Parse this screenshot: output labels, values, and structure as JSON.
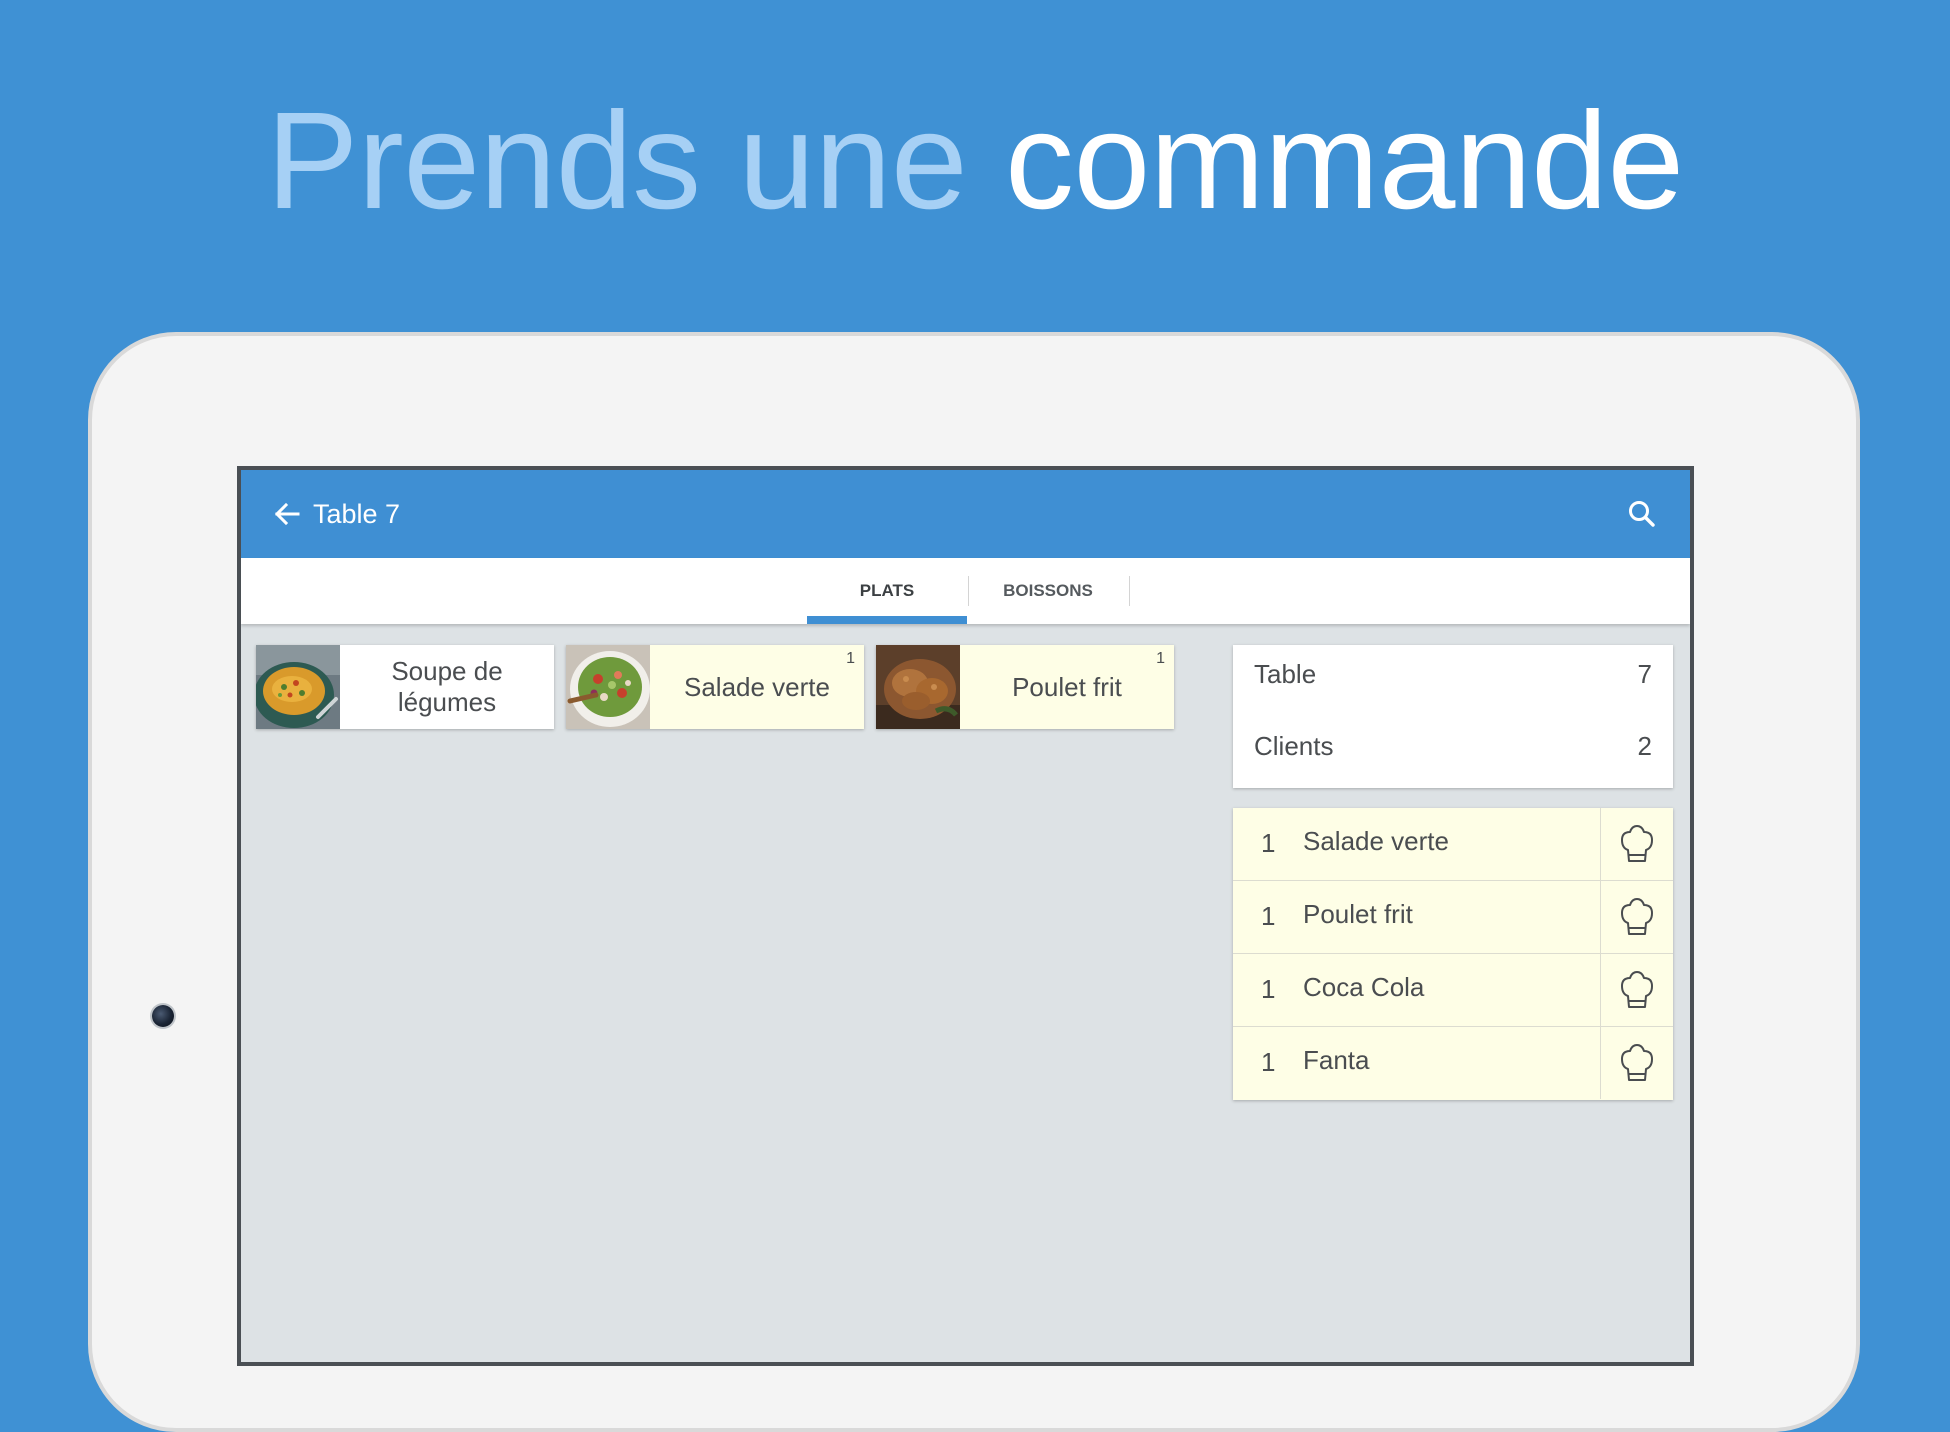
{
  "headline": {
    "light_text": "Prends une",
    "strong_text": "commande"
  },
  "appbar": {
    "title": "Table 7",
    "back_icon": "arrow-back-icon",
    "search_icon": "search-icon"
  },
  "tabs": [
    {
      "label": "PLATS",
      "active": true
    },
    {
      "label": "BOISSONS",
      "active": false
    }
  ],
  "dishes": [
    {
      "name": "Soupe de légumes",
      "count": "",
      "thumb": "soup-bowl-image"
    },
    {
      "name": "Salade verte",
      "count": "1",
      "thumb": "salad-bowl-image"
    },
    {
      "name": "Poulet frit",
      "count": "1",
      "thumb": "fried-chicken-image"
    }
  ],
  "info": {
    "table_label": "Table",
    "table_value": "7",
    "clients_label": "Clients",
    "clients_value": "2"
  },
  "orders": [
    {
      "qty": "1",
      "name": "Salade verte",
      "icon": "chef-hat-icon"
    },
    {
      "qty": "1",
      "name": "Poulet frit",
      "icon": "chef-hat-icon"
    },
    {
      "qty": "1",
      "name": "Coca Cola",
      "icon": "chef-hat-icon"
    },
    {
      "qty": "1",
      "name": "Fanta",
      "icon": "chef-hat-icon"
    }
  ],
  "colors": {
    "background": "#3f91d4",
    "appbar": "#3f8fd3",
    "selected_item": "#fefee6",
    "screen_bg": "#dde2e5"
  }
}
